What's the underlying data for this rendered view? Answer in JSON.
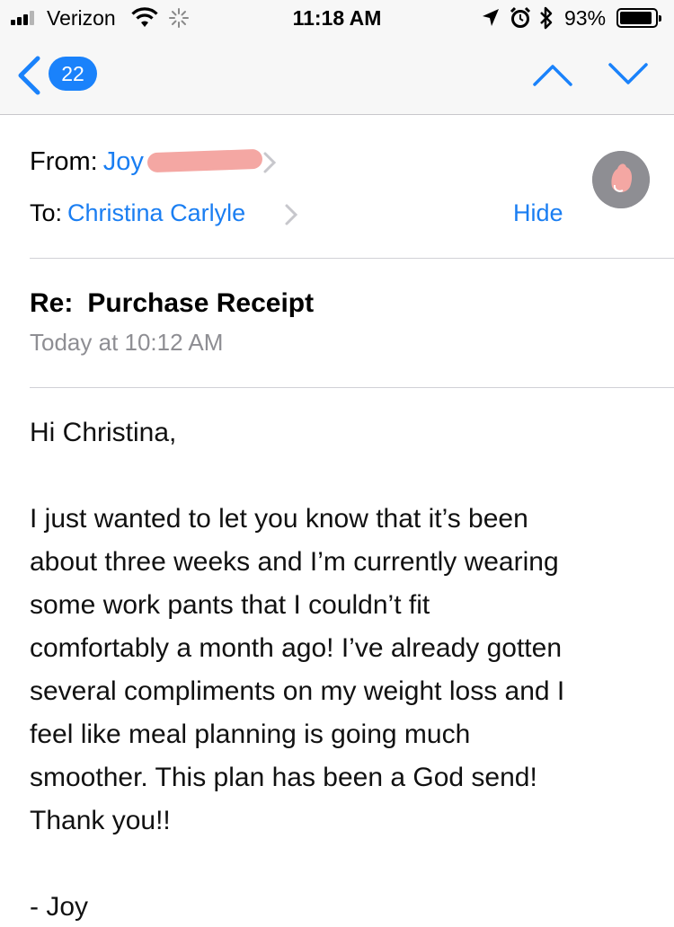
{
  "status_bar": {
    "carrier": "Verizon",
    "time": "11:18 AM",
    "battery_percent": "93%",
    "battery_level": 0.93,
    "icons": [
      "signal-bars-icon",
      "wifi-icon",
      "activity-spinner-icon",
      "location-arrow-icon",
      "alarm-icon",
      "bluetooth-icon",
      "battery-icon"
    ]
  },
  "nav_bar": {
    "unread_count": "22",
    "icons": [
      "back-chevron-icon",
      "previous-message-icon",
      "next-message-icon"
    ]
  },
  "header": {
    "from_label": "From:",
    "from_name": "Joy",
    "to_label": "To:",
    "to_name": "Christina Carlyle",
    "hide_label": "Hide"
  },
  "message": {
    "subject_prefix": "Re:",
    "subject": "Purchase Receipt",
    "date": "Today at 10:12 AM",
    "greeting": "Hi Christina,",
    "lines": [
      "I just wanted to let you know that it’s been",
      "about three weeks and I’m currently wearing",
      "some work pants that I couldn’t fit",
      "comfortably a month ago! I’ve already gotten",
      "several compliments on my weight loss and I",
      "feel like meal planning is going much",
      "smoother. This plan has been a God send!",
      "Thank you!!"
    ],
    "signature": "- Joy"
  },
  "colors": {
    "accent": "#1a7ef2",
    "badge": "#1a82fb",
    "secondary_text": "#8e8e93",
    "bar_background": "#f7f7f7",
    "redaction": "#f4a7a3"
  }
}
